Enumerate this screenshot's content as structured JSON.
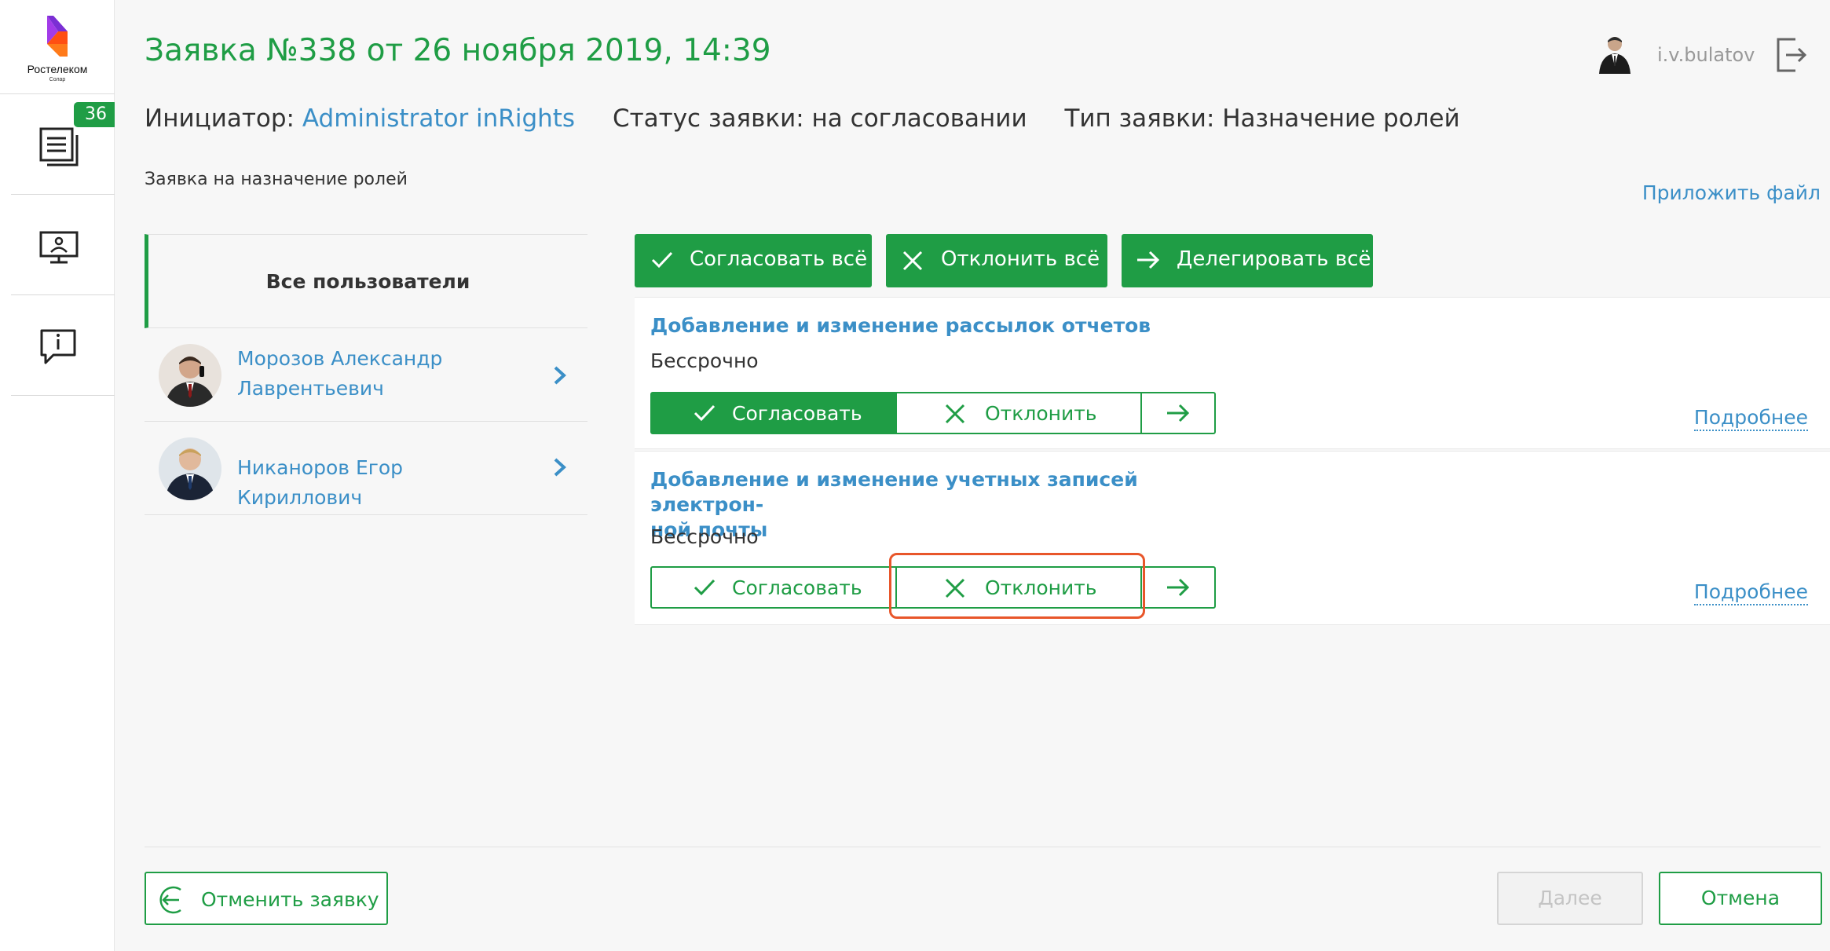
{
  "sidebar": {
    "logo": {
      "name": "Ростелеком",
      "sub": "Солар"
    },
    "items": [
      {
        "icon": "documents-icon",
        "badge": "36"
      },
      {
        "icon": "monitor-icon"
      },
      {
        "icon": "info-chat-icon"
      }
    ]
  },
  "header": {
    "title": "Заявка №338 от 26 ноября 2019, 14:39",
    "user": "i.v.bulatov"
  },
  "meta": {
    "initiator_label": "Инициатор:",
    "initiator_value": "Administrator inRights",
    "status_label": "Статус заявки:",
    "status_value": "на согласовании",
    "type_label": "Тип заявки:",
    "type_value": "Назначение ролей"
  },
  "subtitle": "Заявка на назначение ролей",
  "attach_label": "Приложить файл",
  "users": {
    "header": "Все пользователи",
    "list": [
      {
        "name": "Морозов Александр Лаврентьевич"
      },
      {
        "name": "Никаноров Егор Кириллович"
      }
    ]
  },
  "bulk_actions": {
    "approve_all": "Согласовать всё",
    "reject_all": "Отклонить всё",
    "delegate_all": "Делегировать всё"
  },
  "roles": [
    {
      "title": "Добавление и изменение рассылок отчетов",
      "term": "Бессрочно",
      "approve": "Согласовать",
      "reject": "Отклонить",
      "more": "Подробнее",
      "selected": "approve"
    },
    {
      "title": "Добавление и изменение учетных записей электрон-ной почты",
      "title_line1": "Добавление и изменение учетных записей электрон-",
      "title_line2": "ной почты",
      "term": "Бессрочно",
      "approve": "Согласовать",
      "reject": "Отклонить",
      "more": "Подробнее",
      "selected": "none"
    }
  ],
  "footer": {
    "cancel_request": "Отменить заявку",
    "next": "Далее",
    "cancel": "Отмена"
  },
  "colors": {
    "accent": "#1f9d45",
    "link": "#3b8fc7",
    "highlight": "#e8562a"
  }
}
